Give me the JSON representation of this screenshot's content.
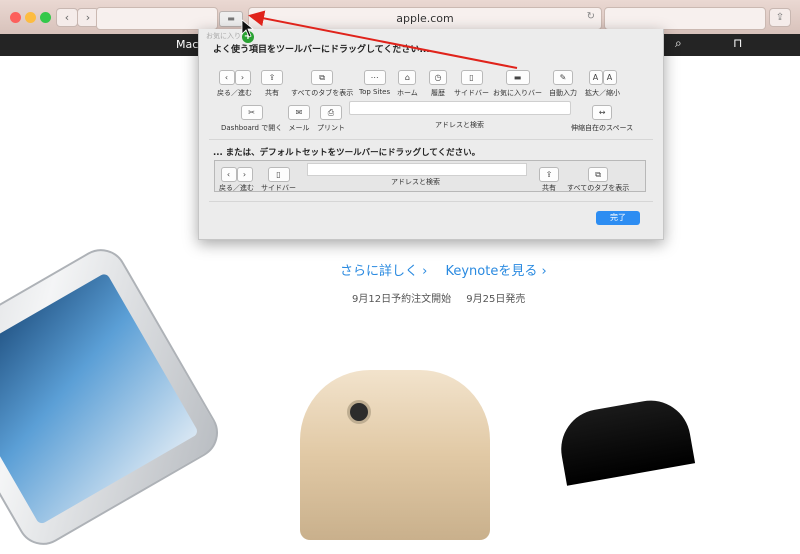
{
  "browser": {
    "url": "apple.com",
    "buttons": {
      "back": "‹",
      "forward": "›"
    }
  },
  "site": {
    "nav_mac": "Mac",
    "links": [
      "さらに詳しく ›",
      "Keynoteを見る ›"
    ],
    "dates": [
      "9月12日予約注文開始",
      "9月25日発売"
    ]
  },
  "sheet": {
    "faded_label": "お気に入り",
    "title": "よく使う項目をツールバーにドラッグしてください...",
    "items_row1": [
      {
        "label": "戻る／進む"
      },
      {
        "label": "共有"
      },
      {
        "label": "すべてのタブを表示"
      },
      {
        "label": "Top Sites"
      },
      {
        "label": "ホーム"
      },
      {
        "label": "履歴"
      },
      {
        "label": "サイドバー"
      },
      {
        "label": "お気に入りバー"
      },
      {
        "label": "自動入力"
      },
      {
        "label": "拡大／縮小"
      }
    ],
    "items_row2": [
      {
        "label": "Dashboard で開く"
      },
      {
        "label": "メール"
      },
      {
        "label": "プリント"
      },
      {
        "label": "アドレスと検索"
      },
      {
        "label": "伸縮自在のスペース"
      }
    ],
    "default_title": "... または、デフォルトセットをツールバーにドラッグしてください。",
    "default_set": [
      {
        "label": "戻る／進む"
      },
      {
        "label": "サイドバー"
      },
      {
        "label": "アドレスと検索"
      },
      {
        "label": "共有"
      },
      {
        "label": "すべてのタブを表示"
      }
    ],
    "done": "完了"
  },
  "colors": {
    "accent": "#2d8df2",
    "arrow": "#e0231b",
    "link": "#2a8ae0"
  }
}
